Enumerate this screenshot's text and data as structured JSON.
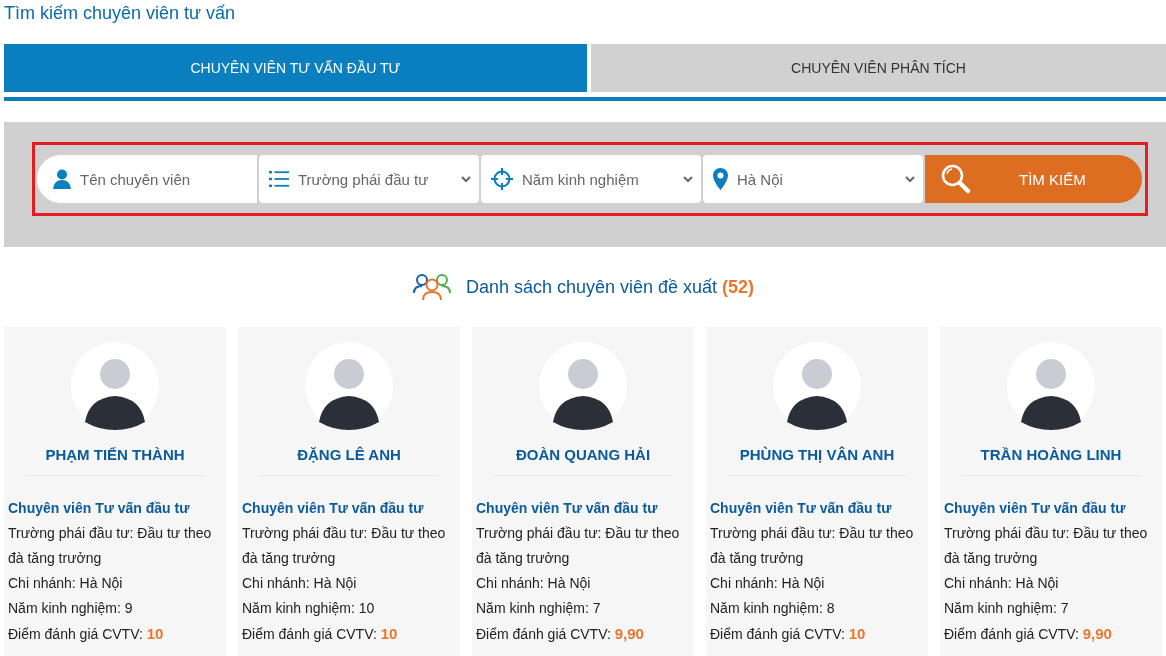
{
  "page_title": "Tìm kiếm chuyên viên tư vấn",
  "tabs": [
    {
      "label": "CHUYÊN VIÊN TƯ VẤN ĐẦU TƯ",
      "selected": true
    },
    {
      "label": "CHUYÊN VIÊN PHÂN TÍCH",
      "selected": false
    }
  ],
  "search": {
    "fields": [
      {
        "kind": "text",
        "placeholder": "Tên chuyên viên"
      },
      {
        "kind": "select",
        "placeholder": "Trường phái đầu tư"
      },
      {
        "kind": "select",
        "placeholder": "Năm kinh nghiệm"
      },
      {
        "kind": "select",
        "value": "Hà Nội"
      }
    ],
    "button": "TÌM KIẾM"
  },
  "list_heading": {
    "text": "Danh sách chuyên viên đề xuất",
    "count": "(52)"
  },
  "advisors": [
    {
      "name": "PHẠM TIẾN THÀNH",
      "role": "Chuyên viên Tư vấn đầu tư",
      "school_label": "Trường phái đầu tư:",
      "school": "Đầu tư theo đà tăng trưởng",
      "branch_label": "Chi nhánh:",
      "branch": "Hà Nội",
      "exp_label": "Năm kinh nghiệm:",
      "exp": "9",
      "score_label": "Điểm đánh giá CVTV:",
      "score": "10"
    },
    {
      "name": "ĐẶNG LÊ ANH",
      "role": "Chuyên viên Tư vấn đầu tư",
      "school_label": "Trường phái đầu tư:",
      "school": "Đầu tư theo đà tăng trưởng",
      "branch_label": "Chi nhánh:",
      "branch": "Hà Nội",
      "exp_label": "Năm kinh nghiệm:",
      "exp": "10",
      "score_label": "Điểm đánh giá CVTV:",
      "score": "10"
    },
    {
      "name": "ĐOÀN QUANG HẢI",
      "role": "Chuyên viên Tư vấn đầu tư",
      "school_label": "Trường phái đầu tư:",
      "school": "Đầu tư theo đà tăng trưởng",
      "branch_label": "Chi nhánh:",
      "branch": "Hà Nội",
      "exp_label": "Năm kinh nghiệm:",
      "exp": "7",
      "score_label": "Điểm đánh giá CVTV:",
      "score": "9,90"
    },
    {
      "name": "PHÙNG THỊ VÂN ANH",
      "role": "Chuyên viên Tư vấn đầu tư",
      "school_label": "Trường phái đầu tư:",
      "school": "Đầu tư theo đà tăng trưởng",
      "branch_label": "Chi nhánh:",
      "branch": "Hà Nội",
      "exp_label": "Năm kinh nghiệm:",
      "exp": "8",
      "score_label": "Điểm đánh giá CVTV:",
      "score": "10"
    },
    {
      "name": "TRẦN HOÀNG LINH",
      "role": "Chuyên viên Tư vấn đầu tư",
      "school_label": "Trường phái đầu tư:",
      "school": "Đầu tư theo đà tăng trưởng",
      "branch_label": "Chi nhánh:",
      "branch": "Hà Nội",
      "exp_label": "Năm kinh nghiệm:",
      "exp": "7",
      "score_label": "Điểm đánh giá CVTV:",
      "score": "9,90"
    }
  ]
}
